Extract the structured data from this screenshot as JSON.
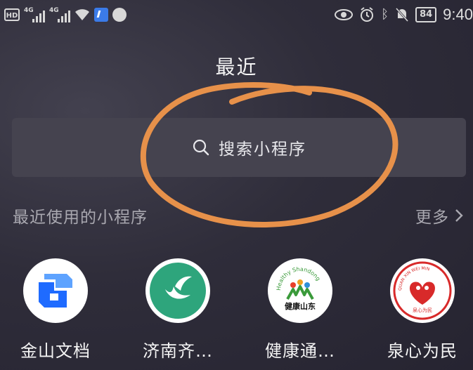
{
  "status_bar": {
    "hd": "HD",
    "hd_sub": "2",
    "signal1": "4G",
    "signal2": "4G",
    "battery": "84",
    "time": "9:40"
  },
  "header": {
    "title": "最近"
  },
  "search": {
    "placeholder": "搜索小程序"
  },
  "recent": {
    "title": "最近使用的小程序",
    "more": "更多"
  },
  "apps": [
    {
      "name": "金山文档",
      "icon": "kingsoft-docs-icon"
    },
    {
      "name": "济南齐…",
      "icon": "jinan-qi-icon"
    },
    {
      "name": "健康通…",
      "icon": "health-pass-icon",
      "logo_text": "健康山东",
      "logo_arc": "Healthy Shandong"
    },
    {
      "name": "泉心为民",
      "icon": "quanxin-icon",
      "logo_text": "泉心为民",
      "logo_arc": "QUAN XIN WEI MIN"
    }
  ],
  "colors": {
    "annotation": "#e7914a",
    "background": "#2f2d3a",
    "search_bg": "#45434f"
  }
}
